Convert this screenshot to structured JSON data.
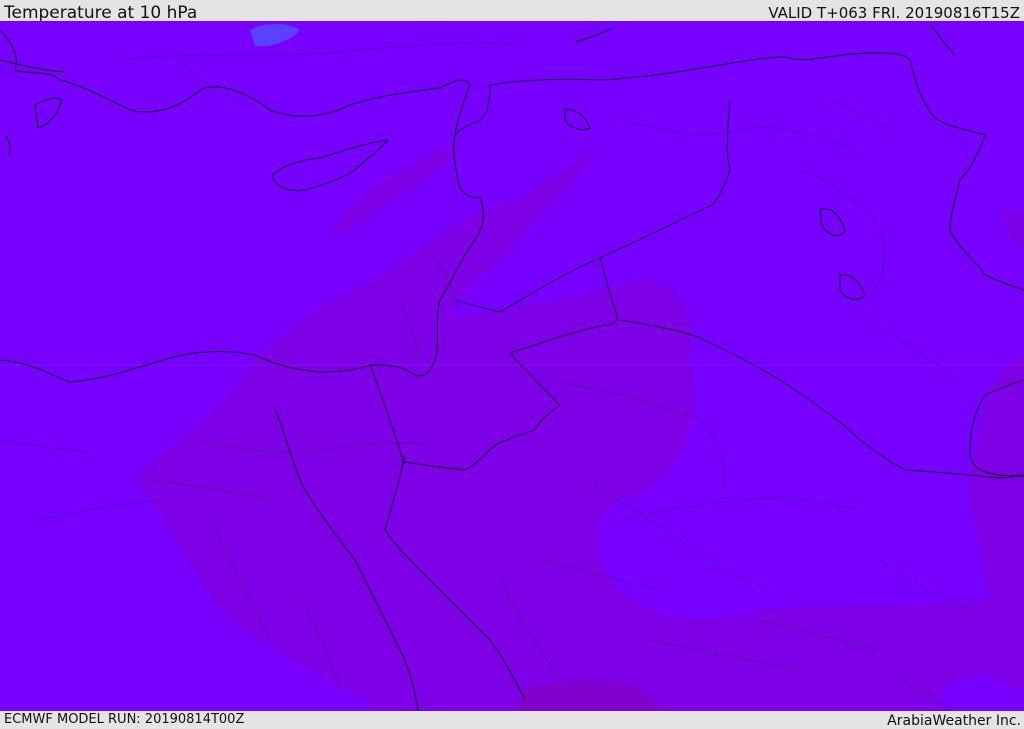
{
  "header": {
    "title": "Temperature at 10 hPa",
    "valid_time": "VALID T+063 FRI. 20190816T15Z"
  },
  "footer": {
    "model_run": "ECMWF MODEL RUN: 20190814T00Z",
    "credit": "ArabiaWeather Inc."
  },
  "map": {
    "colors": {
      "base_field": "#7800ff",
      "warm_band": "#7e00e6",
      "warmest_patch": "#8000cc",
      "cool_patch": "#5a40ff",
      "coastline": "#101030",
      "border": "#101030"
    }
  }
}
